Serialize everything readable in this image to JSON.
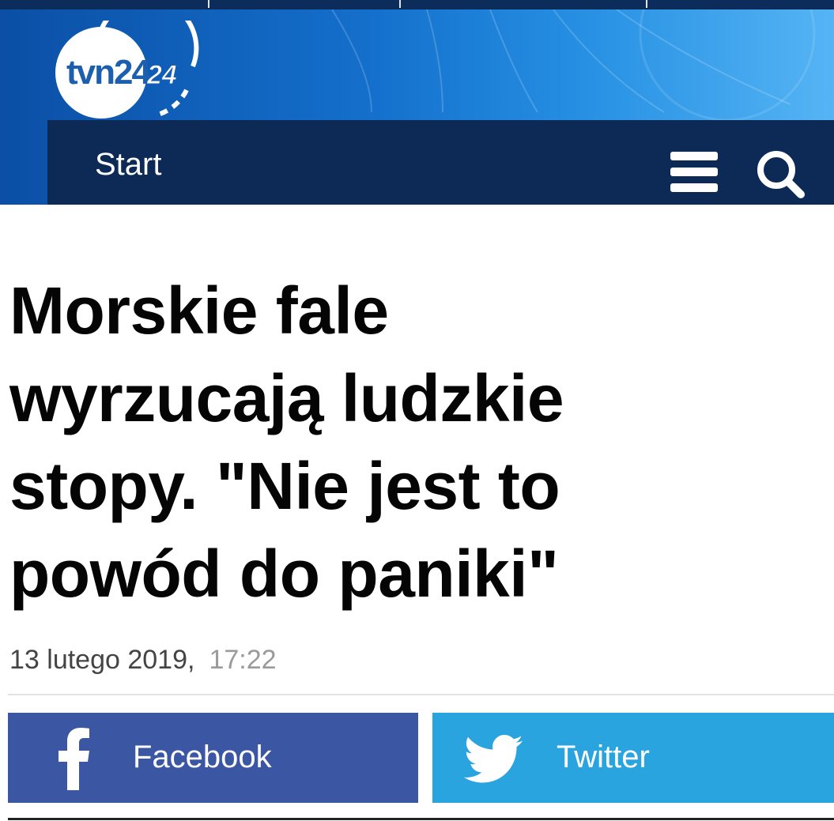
{
  "header": {
    "logo_text": "tvn24",
    "nav_label": "Start",
    "brand_color": "#0c2a55",
    "banner_color": "#1470cc",
    "menu_icon": "hamburger-menu-icon",
    "search_icon": "search-icon"
  },
  "article": {
    "headline_lines": [
      "Morskie fale",
      "wyrzucają ludzkie",
      "stopy. \"Nie jest to",
      "powód do paniki\""
    ],
    "date": "13 lutego 2019,",
    "time": "17:22"
  },
  "share": {
    "facebook_label": "Facebook",
    "facebook_icon": "facebook-icon",
    "facebook_color": "#3b57a4",
    "twitter_label": "Twitter",
    "twitter_icon": "twitter-bird-icon",
    "twitter_color": "#2aa4de"
  }
}
